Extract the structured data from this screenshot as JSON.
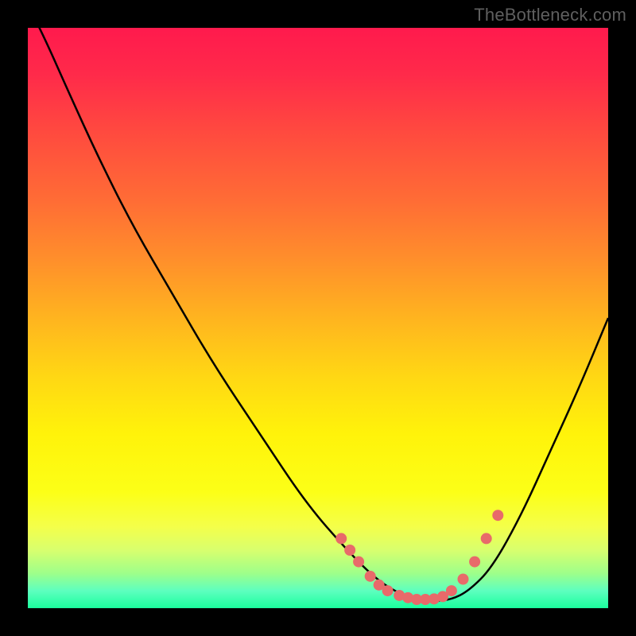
{
  "watermark": "TheBottleneck.com",
  "chart_data": {
    "type": "line",
    "title": "",
    "xlabel": "",
    "ylabel": "",
    "xlim": [
      0,
      100
    ],
    "ylim": [
      0,
      100
    ],
    "grid": false,
    "series": [
      {
        "name": "bottleneck-curve",
        "type": "line",
        "color": "#000000",
        "x": [
          0,
          3,
          7,
          12,
          18,
          25,
          32,
          40,
          48,
          55,
          60,
          64,
          67,
          70,
          73,
          76,
          80,
          85,
          90,
          95,
          100
        ],
        "y": [
          104,
          98,
          89,
          78,
          66,
          54,
          42,
          30,
          18,
          10,
          5,
          2.5,
          1.5,
          1.2,
          1.5,
          3,
          7,
          16,
          27,
          38,
          50
        ]
      },
      {
        "name": "bottom-markers",
        "type": "scatter",
        "color": "#e86a6a",
        "x": [
          54,
          55.5,
          57,
          59,
          60.5,
          62,
          64,
          65.5,
          67,
          68.5,
          70,
          71.5,
          73,
          75,
          77,
          79,
          81
        ],
        "y": [
          12,
          10,
          8,
          5.5,
          4,
          3,
          2.2,
          1.8,
          1.5,
          1.5,
          1.6,
          2,
          3,
          5,
          8,
          12,
          16
        ]
      }
    ]
  }
}
